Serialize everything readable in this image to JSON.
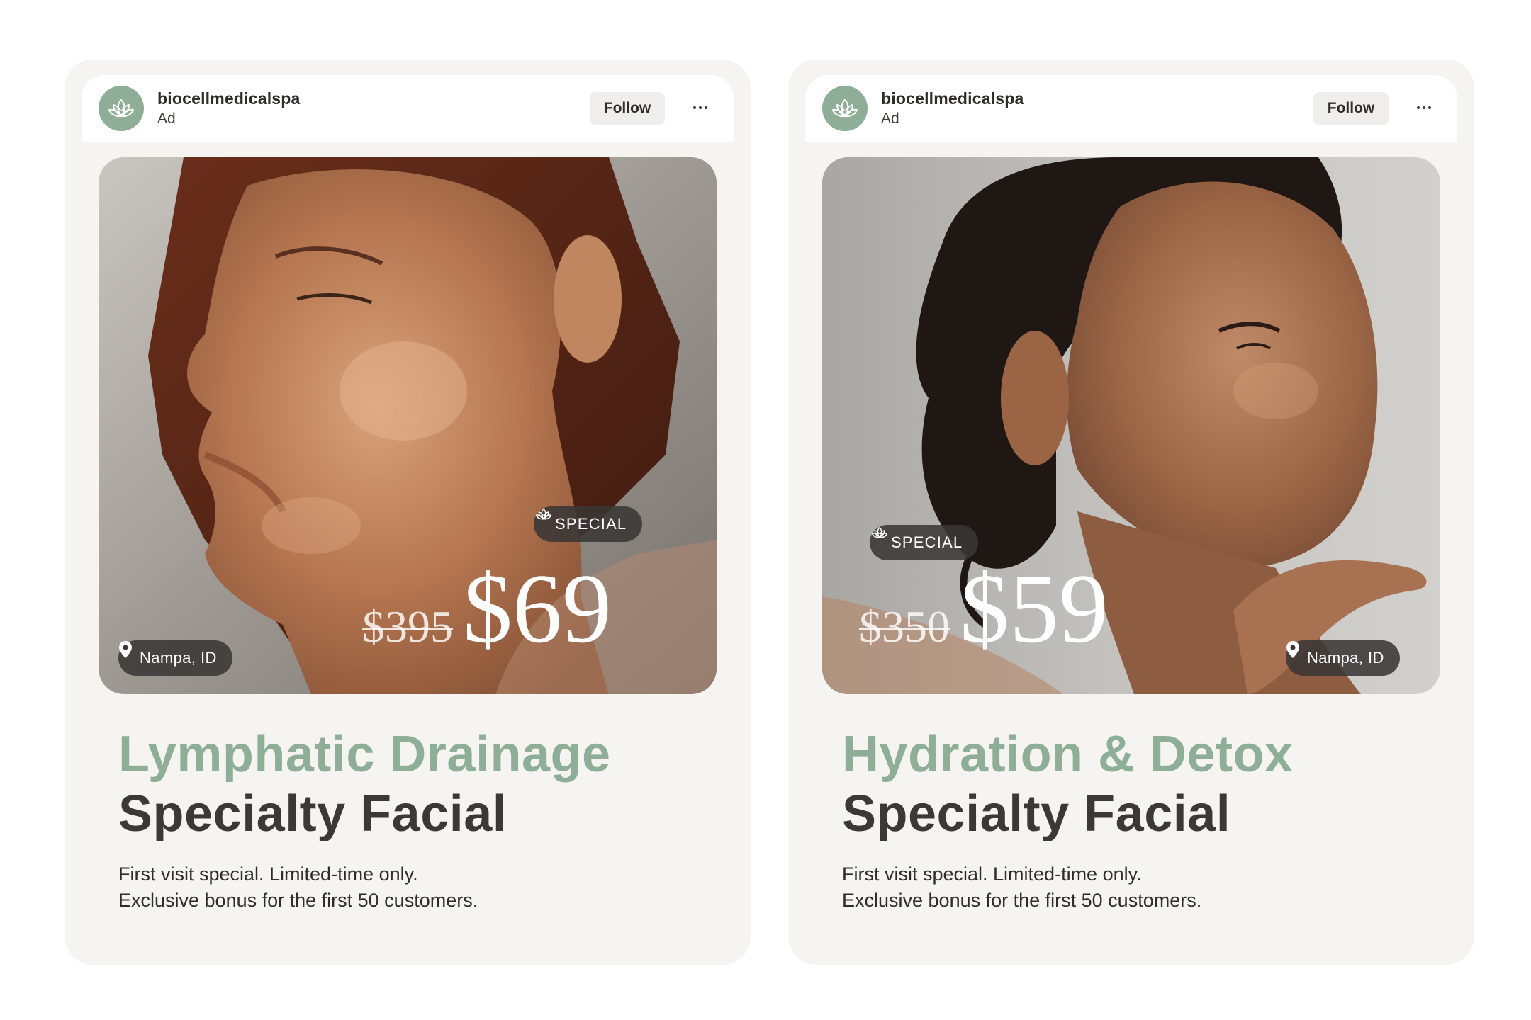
{
  "ads": [
    {
      "account": "biocellmedicalspa",
      "sponsored_label": "Ad",
      "follow_label": "Follow",
      "badge": "SPECIAL",
      "old_price": "$395",
      "new_price": "$69",
      "location": "Nampa, ID",
      "title_line1": "Lymphatic Drainage",
      "title_line2": "Specialty Facial",
      "desc_line1": "First visit special. Limited-time only.",
      "desc_line2": "Exclusive bonus for the first 50 customers."
    },
    {
      "account": "biocellmedicalspa",
      "sponsored_label": "Ad",
      "follow_label": "Follow",
      "badge": "SPECIAL",
      "old_price": "$350",
      "new_price": "$59",
      "location": "Nampa, ID",
      "title_line1": "Hydration & Detox",
      "title_line2": "Specialty Facial",
      "desc_line1": "First visit special. Limited-time only.",
      "desc_line2": "Exclusive bonus for the first 50 customers."
    }
  ],
  "colors": {
    "accent_green": "#8fae98",
    "dark_text": "#3b3835",
    "card_bg": "#f5f4f1",
    "pill_bg": "#3a3735"
  },
  "icons": [
    "lotus-logo-icon",
    "more-options-icon",
    "lotus-icon",
    "location-pin-icon"
  ]
}
